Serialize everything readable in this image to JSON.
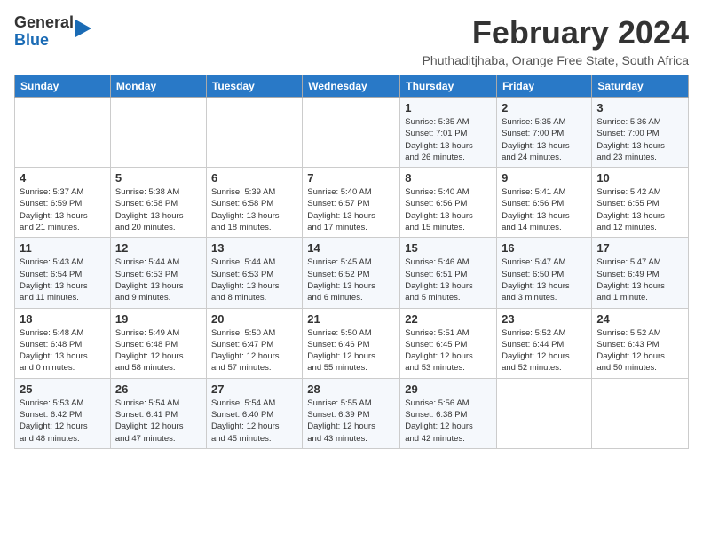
{
  "header": {
    "logo_line1": "General",
    "logo_line2": "Blue",
    "month_title": "February 2024",
    "location": "Phuthaditjhaba, Orange Free State, South Africa"
  },
  "days_of_week": [
    "Sunday",
    "Monday",
    "Tuesday",
    "Wednesday",
    "Thursday",
    "Friday",
    "Saturday"
  ],
  "weeks": [
    [
      {
        "day": "",
        "info": ""
      },
      {
        "day": "",
        "info": ""
      },
      {
        "day": "",
        "info": ""
      },
      {
        "day": "",
        "info": ""
      },
      {
        "day": "1",
        "info": "Sunrise: 5:35 AM\nSunset: 7:01 PM\nDaylight: 13 hours\nand 26 minutes."
      },
      {
        "day": "2",
        "info": "Sunrise: 5:35 AM\nSunset: 7:00 PM\nDaylight: 13 hours\nand 24 minutes."
      },
      {
        "day": "3",
        "info": "Sunrise: 5:36 AM\nSunset: 7:00 PM\nDaylight: 13 hours\nand 23 minutes."
      }
    ],
    [
      {
        "day": "4",
        "info": "Sunrise: 5:37 AM\nSunset: 6:59 PM\nDaylight: 13 hours\nand 21 minutes."
      },
      {
        "day": "5",
        "info": "Sunrise: 5:38 AM\nSunset: 6:58 PM\nDaylight: 13 hours\nand 20 minutes."
      },
      {
        "day": "6",
        "info": "Sunrise: 5:39 AM\nSunset: 6:58 PM\nDaylight: 13 hours\nand 18 minutes."
      },
      {
        "day": "7",
        "info": "Sunrise: 5:40 AM\nSunset: 6:57 PM\nDaylight: 13 hours\nand 17 minutes."
      },
      {
        "day": "8",
        "info": "Sunrise: 5:40 AM\nSunset: 6:56 PM\nDaylight: 13 hours\nand 15 minutes."
      },
      {
        "day": "9",
        "info": "Sunrise: 5:41 AM\nSunset: 6:56 PM\nDaylight: 13 hours\nand 14 minutes."
      },
      {
        "day": "10",
        "info": "Sunrise: 5:42 AM\nSunset: 6:55 PM\nDaylight: 13 hours\nand 12 minutes."
      }
    ],
    [
      {
        "day": "11",
        "info": "Sunrise: 5:43 AM\nSunset: 6:54 PM\nDaylight: 13 hours\nand 11 minutes."
      },
      {
        "day": "12",
        "info": "Sunrise: 5:44 AM\nSunset: 6:53 PM\nDaylight: 13 hours\nand 9 minutes."
      },
      {
        "day": "13",
        "info": "Sunrise: 5:44 AM\nSunset: 6:53 PM\nDaylight: 13 hours\nand 8 minutes."
      },
      {
        "day": "14",
        "info": "Sunrise: 5:45 AM\nSunset: 6:52 PM\nDaylight: 13 hours\nand 6 minutes."
      },
      {
        "day": "15",
        "info": "Sunrise: 5:46 AM\nSunset: 6:51 PM\nDaylight: 13 hours\nand 5 minutes."
      },
      {
        "day": "16",
        "info": "Sunrise: 5:47 AM\nSunset: 6:50 PM\nDaylight: 13 hours\nand 3 minutes."
      },
      {
        "day": "17",
        "info": "Sunrise: 5:47 AM\nSunset: 6:49 PM\nDaylight: 13 hours\nand 1 minute."
      }
    ],
    [
      {
        "day": "18",
        "info": "Sunrise: 5:48 AM\nSunset: 6:48 PM\nDaylight: 13 hours\nand 0 minutes."
      },
      {
        "day": "19",
        "info": "Sunrise: 5:49 AM\nSunset: 6:48 PM\nDaylight: 12 hours\nand 58 minutes."
      },
      {
        "day": "20",
        "info": "Sunrise: 5:50 AM\nSunset: 6:47 PM\nDaylight: 12 hours\nand 57 minutes."
      },
      {
        "day": "21",
        "info": "Sunrise: 5:50 AM\nSunset: 6:46 PM\nDaylight: 12 hours\nand 55 minutes."
      },
      {
        "day": "22",
        "info": "Sunrise: 5:51 AM\nSunset: 6:45 PM\nDaylight: 12 hours\nand 53 minutes."
      },
      {
        "day": "23",
        "info": "Sunrise: 5:52 AM\nSunset: 6:44 PM\nDaylight: 12 hours\nand 52 minutes."
      },
      {
        "day": "24",
        "info": "Sunrise: 5:52 AM\nSunset: 6:43 PM\nDaylight: 12 hours\nand 50 minutes."
      }
    ],
    [
      {
        "day": "25",
        "info": "Sunrise: 5:53 AM\nSunset: 6:42 PM\nDaylight: 12 hours\nand 48 minutes."
      },
      {
        "day": "26",
        "info": "Sunrise: 5:54 AM\nSunset: 6:41 PM\nDaylight: 12 hours\nand 47 minutes."
      },
      {
        "day": "27",
        "info": "Sunrise: 5:54 AM\nSunset: 6:40 PM\nDaylight: 12 hours\nand 45 minutes."
      },
      {
        "day": "28",
        "info": "Sunrise: 5:55 AM\nSunset: 6:39 PM\nDaylight: 12 hours\nand 43 minutes."
      },
      {
        "day": "29",
        "info": "Sunrise: 5:56 AM\nSunset: 6:38 PM\nDaylight: 12 hours\nand 42 minutes."
      },
      {
        "day": "",
        "info": ""
      },
      {
        "day": "",
        "info": ""
      }
    ]
  ]
}
